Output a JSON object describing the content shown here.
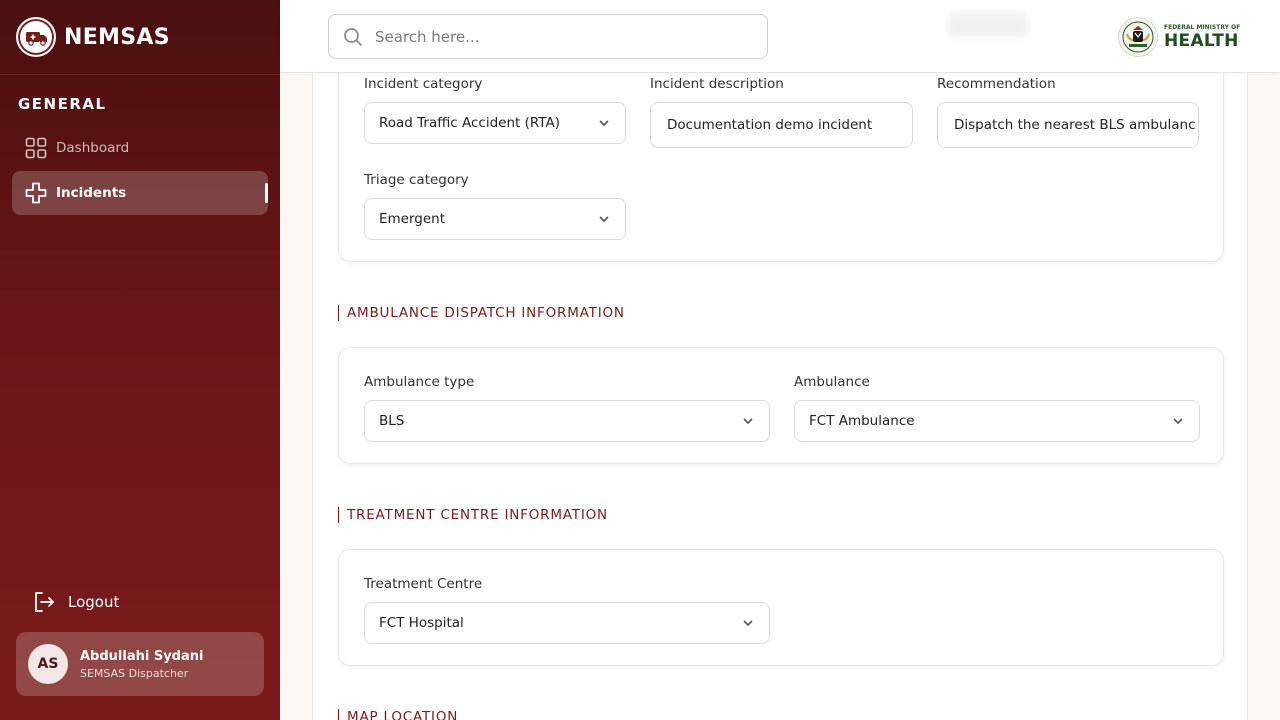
{
  "brand": {
    "name": "NEMSAS",
    "logo_icon": "ambulance-icon"
  },
  "sidebar": {
    "section_label": "GENERAL",
    "items": [
      {
        "label": "Dashboard",
        "icon": "grid-icon",
        "active": false
      },
      {
        "label": "Incidents",
        "icon": "medical-cross-icon",
        "active": true
      }
    ],
    "logout_label": "Logout",
    "user": {
      "initials": "AS",
      "name": "Abdullahi Sydani",
      "role": "SEMSAS Dispatcher"
    }
  },
  "header": {
    "search_placeholder": "Search here...",
    "ministry_small": "FEDERAL MINISTRY OF",
    "ministry_big": "HEALTH"
  },
  "incident": {
    "category_label": "Incident category",
    "category_value": "Road Traffic Accident (RTA)",
    "description_label": "Incident description",
    "description_value": "Documentation demo incident",
    "recommendation_label": "Recommendation",
    "recommendation_value": "Dispatch the nearest BLS ambulanc",
    "triage_label": "Triage category",
    "triage_value": "Emergent"
  },
  "ambulance_section": {
    "title": "AMBULANCE DISPATCH INFORMATION",
    "type_label": "Ambulance type",
    "type_value": "BLS",
    "ambulance_label": "Ambulance",
    "ambulance_value": "FCT Ambulance"
  },
  "treatment_section": {
    "title": "TREATMENT CENTRE INFORMATION",
    "centre_label": "Treatment Centre",
    "centre_value": "FCT Hospital"
  },
  "map_section": {
    "title": "MAP LOCATION"
  },
  "colors": {
    "brand_dark": "#4a0f0f",
    "brand": "#7a1b1b",
    "ministry_green": "#1f4d1f"
  }
}
